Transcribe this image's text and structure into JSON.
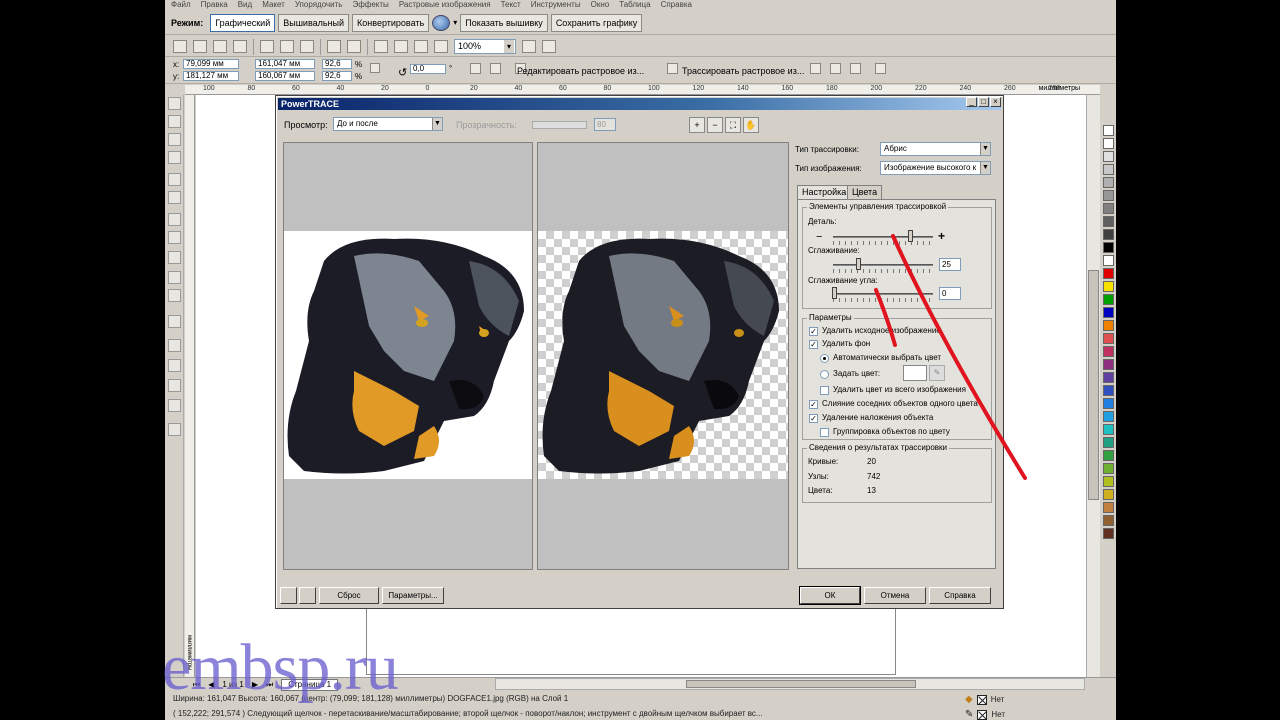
{
  "menu": [
    "Файл",
    "Правка",
    "Вид",
    "Макет",
    "Упорядочить",
    "Эффекты",
    "Растровые изображения",
    "Текст",
    "Инструменты",
    "Окно",
    "Таблица",
    "Справка"
  ],
  "modebar": {
    "label": "Режим:",
    "buttons": [
      "Графический",
      "Вышивальный",
      "Конвертировать",
      "Показать вышивку",
      "Сохранить графику"
    ]
  },
  "toolbar": {
    "zoom": "100%"
  },
  "propbar": {
    "x_label": "x:",
    "x": "79,099 мм",
    "y_label": "y:",
    "y": "181,127 мм",
    "w": "161,047 мм",
    "h": "160,067 мм",
    "sx": "92,6",
    "sy": "92,6",
    "sx_unit": "%",
    "sy_unit": "%",
    "angle": "0,0",
    "angle_unit": "°",
    "edit_bitmap": "Редактировать растровое из...",
    "trace_bitmap": "Трассировать растровое из..."
  },
  "ruler": {
    "labels": [
      "100",
      "80",
      "60",
      "40",
      "20",
      "0",
      "20",
      "40",
      "60",
      "80",
      "100",
      "120",
      "140",
      "160",
      "180",
      "200",
      "220",
      "240",
      "260",
      "280"
    ],
    "unit": "миллиметры",
    "v_unit": "миллиметры"
  },
  "dialog": {
    "title": "PowerTRACE",
    "preview_label": "Просмотр:",
    "preview_value": "До и после",
    "transparency_label": "Прозрачность:",
    "transparency_value": "80",
    "trace_type_label": "Тип трассировки:",
    "trace_type_value": "Абрис",
    "image_type_label": "Тип изображения:",
    "image_type_value": "Изображение высокого к",
    "tabs": [
      "Настройка",
      "Цвета"
    ],
    "controls_group": "Элементы управления трассировкой",
    "detail_label": "Деталь:",
    "smoothing_label": "Сглаживание:",
    "smoothing_value": "25",
    "corner_label": "Сглаживание угла:",
    "corner_value": "0",
    "params_group": "Параметры",
    "options": [
      {
        "label": "Удалить исходное изображение",
        "checked": true
      },
      {
        "label": "Удалить фон",
        "checked": true
      },
      {
        "label": "Автоматически выбрать цвет",
        "radio": true,
        "on": true
      },
      {
        "label": "Задать цвет:",
        "radio": true,
        "on": false
      },
      {
        "label": "Удалить цвет из всего изображения",
        "checked": false
      },
      {
        "label": "Слияние соседних объектов одного цвета",
        "checked": true
      },
      {
        "label": "Удаление наложения объекта",
        "checked": true
      },
      {
        "label": "Группировка объектов по цвету",
        "checked": false
      }
    ],
    "results_group": "Сведения о результатах трассировки",
    "curves_label": "Кривые:",
    "curves_value": "20",
    "nodes_label": "Узлы:",
    "nodes_value": "742",
    "colors_label": "Цвета:",
    "colors_value": "13",
    "reset_btn": "Сброс",
    "options_btn": "Параметры...",
    "ok_btn": "ОК",
    "cancel_btn": "Отмена",
    "help_btn": "Справка"
  },
  "bottombar": {
    "page_info": "1 из 1",
    "page_tab": "Страница 1"
  },
  "status": {
    "row1": "Ширина: 161,047  Высота: 160,067 (центр: (79,099; 181,128)  миллиметры)        DOGFACE1.jpg (RGB) на Слой 1",
    "row2": "( 152,222; 291,574 )   Следующий щелчок - перетаскивание/масштабирование; второй щелчок - поворот/наклон; инструмент с двойным щелчком выбирает вс...",
    "fill": "Нет",
    "line": "Нет"
  },
  "watermark": "embsp.ru",
  "colors": {
    "palette": [
      "#ffffff",
      "#ffffff",
      "#e0e0e0",
      "#c8c8c8",
      "#b0b0b0",
      "#989898",
      "#808080",
      "#606060",
      "#404040",
      "#000000",
      "#ffffff",
      "#e00000",
      "#f5e000",
      "#00a000",
      "#0000c0",
      "#f08000",
      "#e05050",
      "#c03060",
      "#903080",
      "#6040a0",
      "#3050c0",
      "#2080e0",
      "#20a0e0",
      "#20c0c0",
      "#20a080",
      "#30a040",
      "#70b030",
      "#b0c020",
      "#d0b020",
      "#c08040",
      "#906030",
      "#603020"
    ]
  }
}
